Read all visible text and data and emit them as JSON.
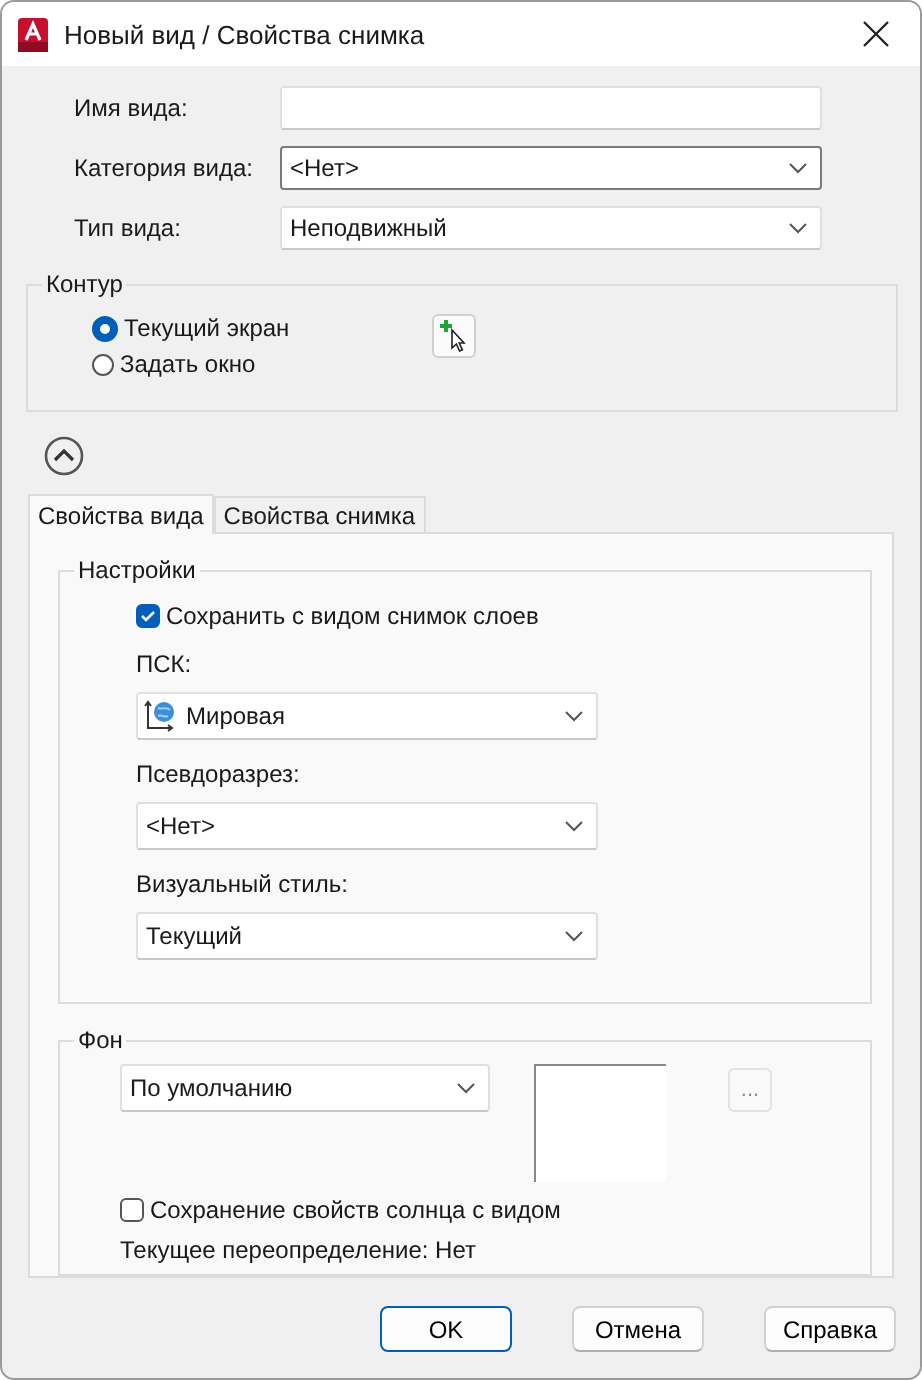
{
  "window": {
    "title": "Новый вид / Свойства снимка"
  },
  "fields": [
    {
      "label": "Имя вида:",
      "kind": "text",
      "focused": false
    },
    {
      "label": "Категория вида:",
      "kind": "dropdown",
      "value": "<Нет>",
      "focused": true
    },
    {
      "label": "Тип вида:",
      "kind": "dropdown",
      "value": "Неподвижный",
      "focused": false
    }
  ],
  "contour": {
    "title": "Контур",
    "options": [
      {
        "label": "Текущий экран",
        "selected": true
      },
      {
        "label": "Задать окно",
        "selected": false
      }
    ]
  },
  "tabs": [
    {
      "label": "Свойства вида",
      "selected": true
    },
    {
      "label": "Свойства снимка",
      "selected": false
    }
  ],
  "settings": {
    "title": "Настройки",
    "save_layers": {
      "label": "Сохранить с видом снимок слоев",
      "checked": true
    },
    "fields": [
      {
        "label": "ПСК:",
        "kind": "ucs",
        "value": "Мировая"
      },
      {
        "label": "Псевдоразрез:",
        "kind": "plain",
        "value": "<Нет>"
      },
      {
        "label": "Визуальный стиль:",
        "kind": "plain",
        "value": "Текущий"
      }
    ]
  },
  "background": {
    "title": "Фон",
    "value": "По умолчанию",
    "browse": {
      "label": "...",
      "disabled": true
    },
    "sun": {
      "label": "Сохранение свойств солнца с видом",
      "checked": false
    },
    "override": "Текущее переопределение: Нет"
  },
  "buttons": [
    {
      "label": "OK",
      "default": true
    },
    {
      "label": "Отмена",
      "default": false
    },
    {
      "label": "Справка",
      "default": false
    }
  ]
}
